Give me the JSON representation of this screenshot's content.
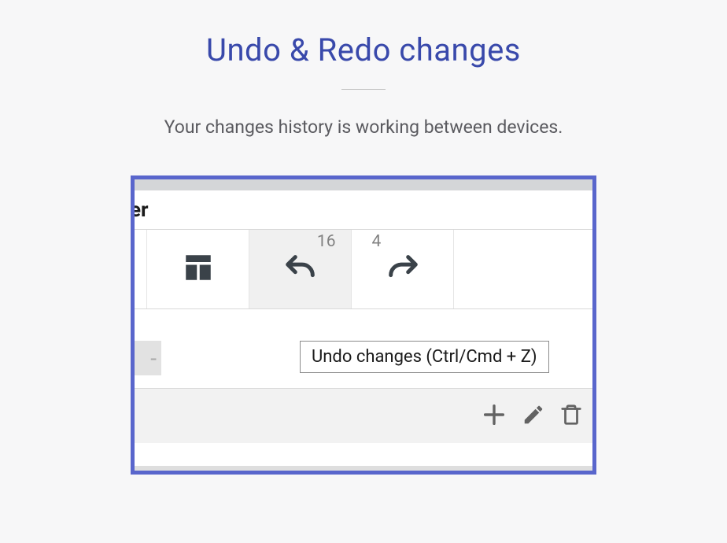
{
  "title": "Undo & Redo changes",
  "subtitle": "Your changes history is working between devices.",
  "frame": {
    "header_fragment": "er",
    "undo_count": "16",
    "redo_count": "4",
    "tooltip": "Undo changes (Ctrl/Cmd + Z)"
  }
}
